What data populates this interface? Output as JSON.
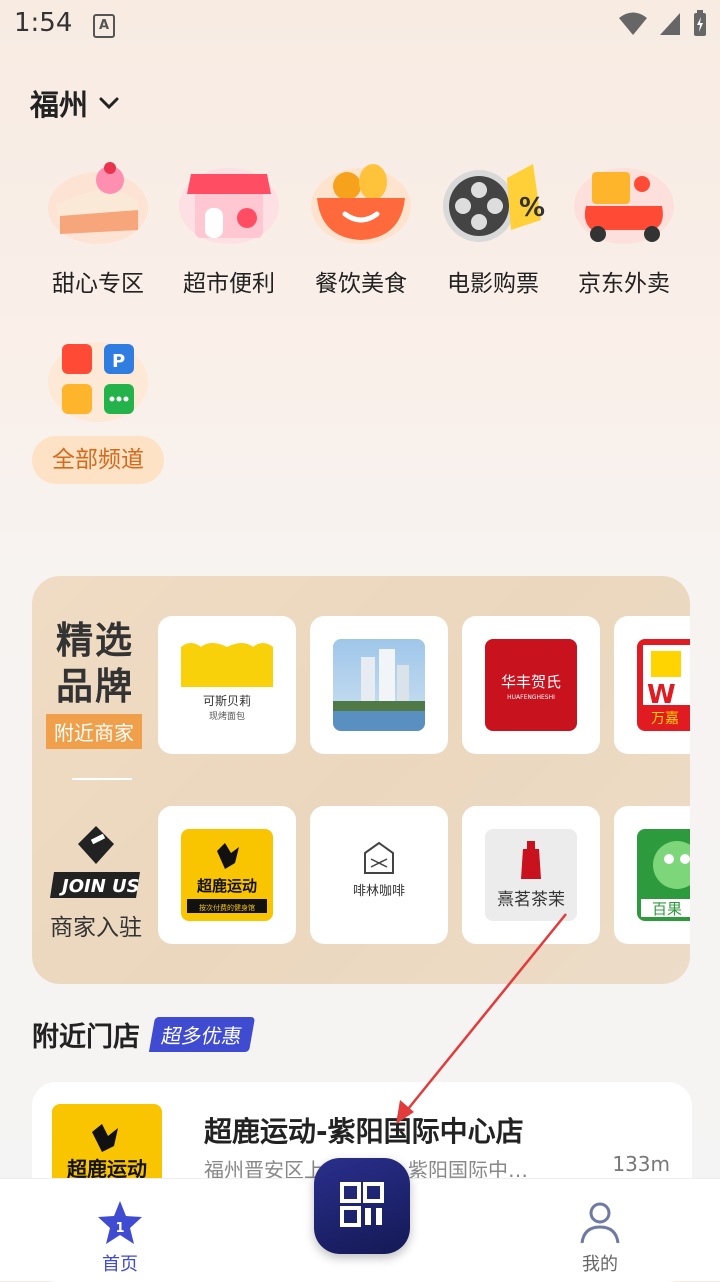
{
  "status": {
    "time": "1:54",
    "notif_letter": "A"
  },
  "city": {
    "name": "福州"
  },
  "categories": [
    {
      "label": "甜心专区",
      "icon": "cake-icon"
    },
    {
      "label": "超市便利",
      "icon": "store-icon"
    },
    {
      "label": "餐饮美食",
      "icon": "food-basket-icon"
    },
    {
      "label": "电影购票",
      "icon": "film-reel-icon"
    },
    {
      "label": "京东外卖",
      "icon": "scooter-icon"
    }
  ],
  "all_channels": {
    "label": "全部频道",
    "icon": "app-grid-icon"
  },
  "brands": {
    "title_line1": "精选",
    "title_line2": "品牌",
    "tag": "附近商家",
    "join_logo_text": "JOIN US",
    "join_label": "商家入驻",
    "row1": [
      {
        "name": "可斯贝莉",
        "sub": "现烤面包",
        "color": "#f9d10a"
      },
      {
        "name": "building-photo",
        "color": "#6fa7d6"
      },
      {
        "name": "华丰贺氏",
        "sub": "HUAFENGHESHI",
        "color": "#c8121e"
      },
      {
        "name": "万嘉",
        "color": "#e11b22"
      }
    ],
    "row2": [
      {
        "name": "超鹿运动",
        "sub": "按次付费的健身馆",
        "color": "#f9c400"
      },
      {
        "name": "啡林咖啡",
        "color": "#ffffff"
      },
      {
        "name": "熹茗茶茉",
        "color": "#eeeeee"
      },
      {
        "name": "百果",
        "color": "#2d9a3e"
      }
    ]
  },
  "nearby": {
    "title": "附近门店",
    "badge": "超多优惠",
    "store": {
      "name": "超鹿运动-紫阳国际中心店",
      "address": "福州晋安区上",
      "address_tail": "紫阳国际中…",
      "distance": "133m",
      "logo_text": "超鹿运动"
    }
  },
  "tabbar": {
    "home": "首页",
    "mine": "我的"
  },
  "colors": {
    "accent": "#3f4bd1",
    "orange": "#f0a04a"
  }
}
